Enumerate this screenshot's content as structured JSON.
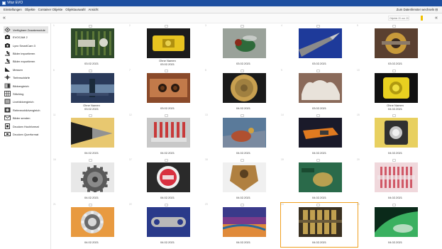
{
  "window": {
    "title": "Vitur EVO"
  },
  "menu": {
    "items": [
      "Einstellungen",
      "Objekte",
      "Container Objekte",
      "Objektauswahl",
      "Ansicht"
    ],
    "right_link": "Zum Datenfenster wechseln ⊟"
  },
  "toolbar": {
    "collapse_left": "«",
    "collapse_right": "«",
    "filter_placeholder": "Objekte 20 von 20"
  },
  "sidebar": {
    "items": [
      {
        "label": "Verfügbare Zusatzmodule",
        "icon": "puzzle-icon"
      },
      {
        "label": "EVOCAM 2",
        "icon": "camera-icon"
      },
      {
        "label": "Lynx SmartCam 3",
        "icon": "camera-icon"
      },
      {
        "label": "Bilder importieren",
        "icon": "microscope-icon"
      },
      {
        "label": "Bilder exportieren",
        "icon": "microscope-icon"
      },
      {
        "label": "Messen",
        "icon": "triangle-ruler-icon"
      },
      {
        "label": "Tiefenschärfe",
        "icon": "crosshair-icon"
      },
      {
        "label": "Bildvergleich",
        "icon": "compare-icon"
      },
      {
        "label": "Stitching",
        "icon": "grid-icon"
      },
      {
        "label": "Livebildvergleich",
        "icon": "live-compare-icon"
      },
      {
        "label": "Referenzbildvergleich",
        "icon": "reference-icon"
      },
      {
        "label": "Bilder senden",
        "icon": "send-icon"
      },
      {
        "label": "Drucken Hochformat",
        "icon": "printer-icon"
      },
      {
        "label": "Drucken Querformat",
        "icon": "printer-landscape-icon"
      }
    ]
  },
  "gallery": {
    "rows": [
      [
        {
          "number": "1",
          "caption_lines": [
            "03.02.2021"
          ],
          "thumb": "circuit-board",
          "colors": [
            "#2f4a2a",
            "#6e8a3e"
          ]
        },
        {
          "number": "2",
          "caption_lines": [
            "Ohne Namen",
            "03.02.2021"
          ],
          "thumb": "yellow-part",
          "colors": [
            "#1c1c1c",
            "#e8c420"
          ]
        },
        {
          "number": "3",
          "caption_lines": [
            "03.02.2021"
          ],
          "thumb": "fly",
          "colors": [
            "#9aa29a",
            "#2e6a3a"
          ]
        },
        {
          "number": "4",
          "caption_lines": [
            "03.02.2021"
          ],
          "thumb": "needle-tip",
          "colors": [
            "#1e3a9a",
            "#8a8a8a"
          ]
        },
        {
          "number": "5",
          "caption_lines": [
            "03.02.2021"
          ],
          "thumb": "gear-shaft",
          "colors": [
            "#5a4030",
            "#c89a3a"
          ]
        }
      ],
      [
        {
          "number": "6",
          "caption_lines": [
            "Ohne Namen",
            "03.02.2021"
          ],
          "thumb": "chip-edge",
          "colors": [
            "#2a3a5a",
            "#6a86a6"
          ]
        },
        {
          "number": "7",
          "caption_lines": [
            "03.02.2021"
          ],
          "thumb": "rusty-holes",
          "colors": [
            "#8a4a2a",
            "#c27a4a"
          ]
        },
        {
          "number": "8",
          "caption_lines": [
            "04.02.2021"
          ],
          "thumb": "cartridge",
          "colors": [
            "#1a1a1a",
            "#c8a050"
          ]
        },
        {
          "number": "9",
          "caption_lines": [
            "03.02.2021"
          ],
          "thumb": "dental",
          "colors": [
            "#e8e2da",
            "#8a6a5a"
          ]
        },
        {
          "number": "10",
          "caption_lines": [
            "Ohne Namen",
            "04.02.2021"
          ],
          "thumb": "yellow-disc",
          "colors": [
            "#111111",
            "#e8d020"
          ]
        }
      ],
      [
        {
          "number": "11",
          "caption_lines": [
            "04.02.2021"
          ],
          "thumb": "drill-bit",
          "colors": [
            "#e8c870",
            "#202020"
          ]
        },
        {
          "number": "12",
          "caption_lines": [
            "04.02.2021"
          ],
          "thumb": "red-connector",
          "colors": [
            "#c8c8c8",
            "#c83a3a"
          ]
        },
        {
          "number": "13",
          "caption_lines": [
            "04.02.2021"
          ],
          "thumb": "pcb-solder",
          "colors": [
            "#5a7a9a",
            "#b05030"
          ]
        },
        {
          "number": "14",
          "caption_lines": [
            "04.02.2021"
          ],
          "thumb": "orange-tool",
          "colors": [
            "#1a1a2a",
            "#e07a20"
          ]
        },
        {
          "number": "15",
          "caption_lines": [
            "04.02.2021"
          ],
          "thumb": "lens-ring",
          "colors": [
            "#e8d060",
            "#303030"
          ]
        }
      ],
      [
        {
          "number": "16",
          "caption_lines": [
            "04.02.2021"
          ],
          "thumb": "steel-gear",
          "colors": [
            "#e8e8e8",
            "#5a5a5a"
          ]
        },
        {
          "number": "17",
          "caption_lines": [
            "04.02.2021"
          ],
          "thumb": "red-seal",
          "colors": [
            "#2a2a2a",
            "#d83040"
          ]
        },
        {
          "number": "18",
          "caption_lines": [
            "04.02.2021"
          ],
          "thumb": "brass-part",
          "colors": [
            "#f0f0f0",
            "#b08040"
          ]
        },
        {
          "number": "19",
          "caption_lines": [
            "04.02.2021"
          ],
          "thumb": "green-circuit",
          "colors": [
            "#2a6a4a",
            "#b8a050"
          ]
        },
        {
          "number": "20",
          "caption_lines": [
            "04.02.2021"
          ],
          "thumb": "red-fibers",
          "colors": [
            "#f0d8dc",
            "#c83a4a"
          ]
        }
      ],
      [
        {
          "number": "21",
          "caption_lines": [
            "04.02.2021"
          ],
          "thumb": "bearing",
          "colors": [
            "#e89a40",
            "#d8d8d8"
          ]
        },
        {
          "number": "22",
          "caption_lines": [
            "04.02.2021"
          ],
          "thumb": "chain-link",
          "colors": [
            "#2a3a8a",
            "#b8b8b8"
          ]
        },
        {
          "number": "23",
          "caption_lines": [
            "04.02.2021"
          ],
          "thumb": "heat-tint",
          "colors": [
            "#3a3a8a",
            "#e08a3a"
          ]
        },
        {
          "number": "24",
          "caption_lines": [
            "04.02.2021"
          ],
          "thumb": "gold-pins",
          "colors": [
            "#3a3020",
            "#c0a050"
          ],
          "selected": true
        },
        {
          "number": "25",
          "caption_lines": [
            "04.02.2021"
          ],
          "thumb": "green-glass",
          "colors": [
            "#0a2a1a",
            "#3ab060"
          ]
        }
      ]
    ]
  }
}
